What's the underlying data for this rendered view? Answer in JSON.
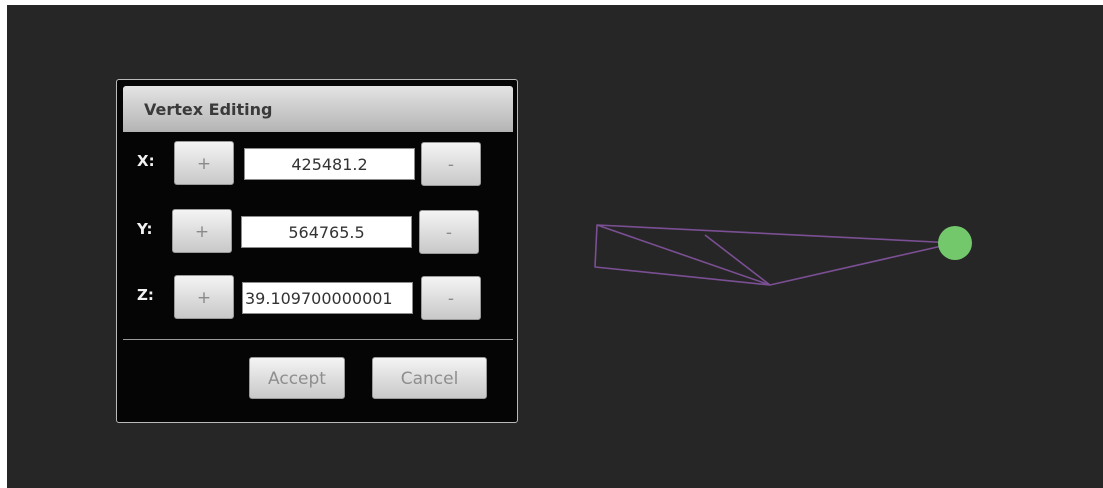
{
  "dialog": {
    "title": "Vertex Editing",
    "rows": [
      {
        "axis_label": "X:",
        "increment_label": "+",
        "value": "425481.2",
        "decrement_label": "-"
      },
      {
        "axis_label": "Y:",
        "increment_label": "+",
        "value": "564765.5",
        "decrement_label": "-"
      },
      {
        "axis_label": "Z:",
        "increment_label": "+",
        "value": "39.109700000001",
        "decrement_label": "-"
      }
    ],
    "accept_label": "Accept",
    "cancel_label": "Cancel"
  },
  "scene": {
    "background_color": "#262626",
    "wireframe_color": "#7a4f93",
    "selected_vertex_color": "#74c86c"
  }
}
